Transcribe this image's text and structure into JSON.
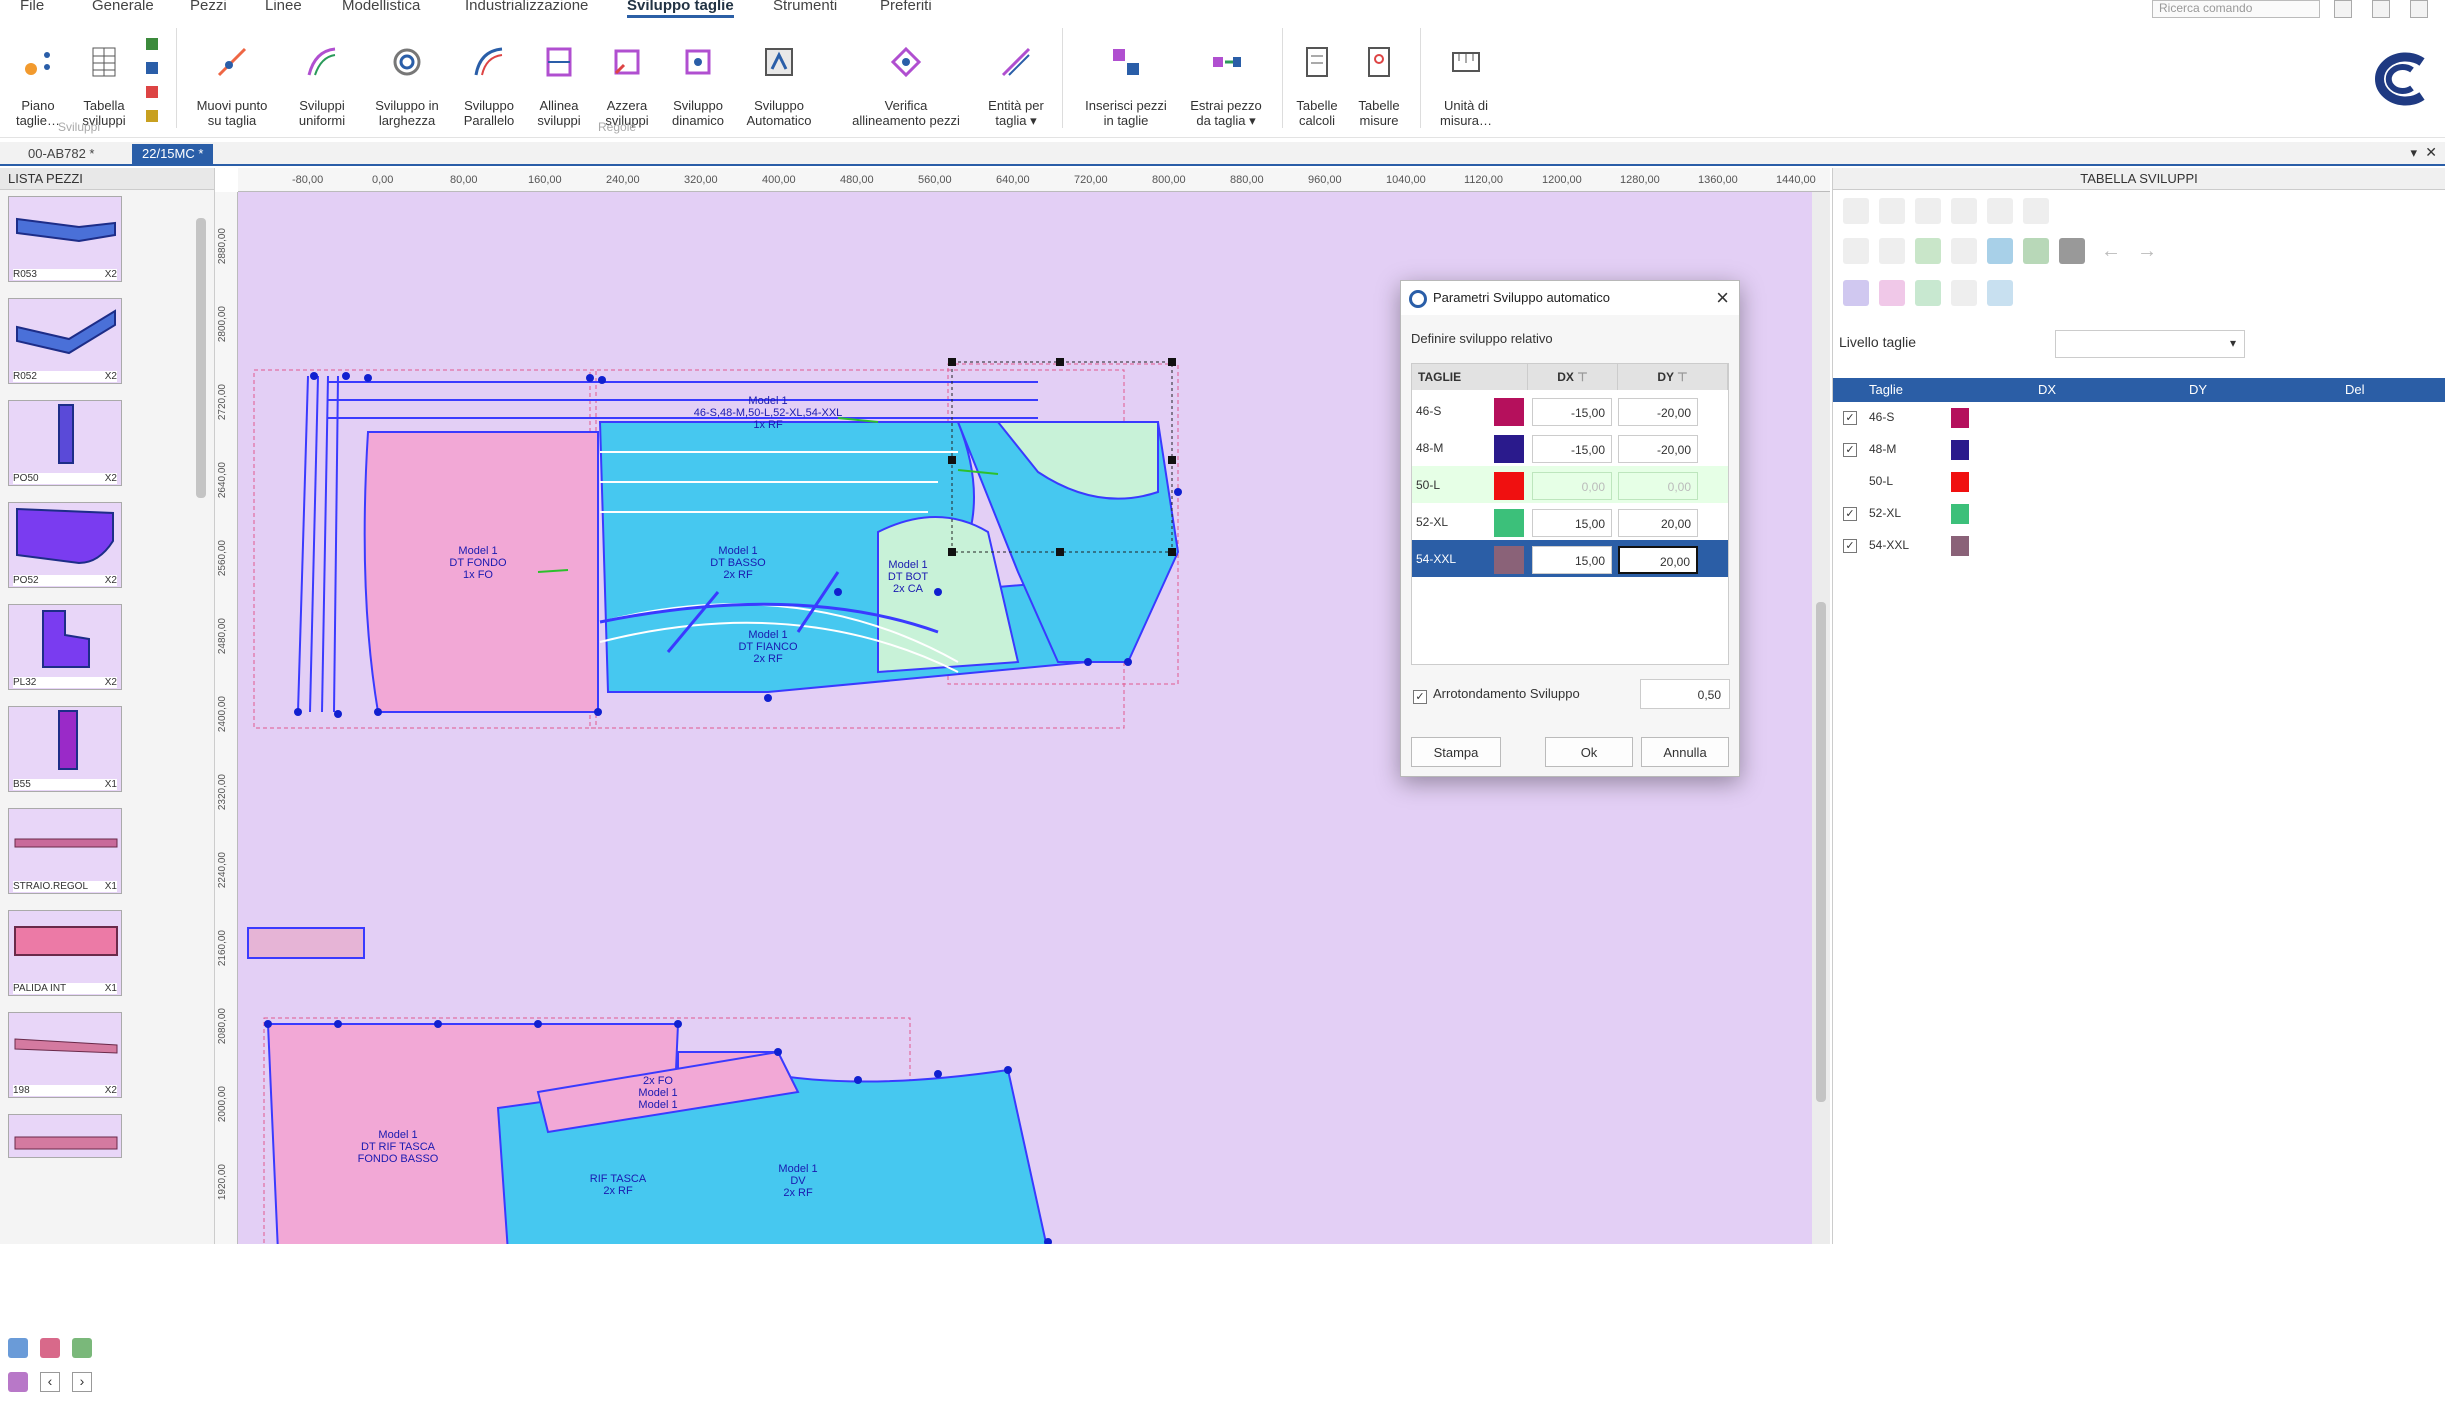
{
  "menu": {
    "items": [
      "File",
      "Generale",
      "Pezzi",
      "Linee",
      "Modellistica",
      "Industrializzazione",
      "Sviluppo taglie",
      "Strumenti",
      "Preferiti"
    ],
    "active": "Sviluppo taglie",
    "search_placeholder": "Ricerca comando"
  },
  "ribbon": {
    "buttons": [
      {
        "label": "Piano\ntaglie…",
        "icon": "size-plan-icon"
      },
      {
        "label": "Tabella\nsviluppi",
        "icon": "table-icon"
      },
      {
        "label": "Muovi punto\nsu taglia",
        "icon": "move-point-icon"
      },
      {
        "label": "Sviluppi\nuniformi",
        "icon": "uniform-grading-icon"
      },
      {
        "label": "Sviluppo in\nlarghezza",
        "icon": "width-grading-icon"
      },
      {
        "label": "Sviluppo\nParallelo",
        "icon": "parallel-grading-icon"
      },
      {
        "label": "Allinea\nsviluppi",
        "icon": "align-grading-icon"
      },
      {
        "label": "Azzera\nsviluppi",
        "icon": "reset-grading-icon"
      },
      {
        "label": "Sviluppo\ndinamico",
        "icon": "dynamic-grading-icon"
      },
      {
        "label": "Sviluppo\nAutomatico",
        "icon": "auto-grading-icon"
      },
      {
        "label": "Verifica\nallineamento pezzi",
        "icon": "verify-alignment-icon"
      },
      {
        "label": "Entità per\ntaglia ▾",
        "icon": "size-entity-icon"
      },
      {
        "label": "Inserisci pezzi\nin taglie",
        "icon": "insert-pieces-icon"
      },
      {
        "label": "Estrai pezzo\nda taglia ▾",
        "icon": "extract-piece-icon"
      },
      {
        "label": "Tabelle\ncalcoli",
        "icon": "calc-table-icon"
      },
      {
        "label": "Tabelle\nmisure",
        "icon": "measure-table-icon"
      },
      {
        "label": "Unità di\nmisura…",
        "icon": "units-icon"
      }
    ],
    "groups": [
      "Sviluppi",
      "Regole"
    ]
  },
  "doc_tabs": [
    "00-AB782 *",
    "22/15MC *"
  ],
  "left_panel": {
    "title": "LISTA PEZZI",
    "pieces": [
      {
        "name": "R053",
        "qty": "X2"
      },
      {
        "name": "R052",
        "qty": "X2"
      },
      {
        "name": "PO50",
        "qty": "X2"
      },
      {
        "name": "PO52",
        "qty": "X2"
      },
      {
        "name": "PL32",
        "qty": "X2"
      },
      {
        "name": "B55",
        "qty": "X1"
      },
      {
        "name": "STRAIO.REGOL",
        "qty": "X1"
      },
      {
        "name": "PALIDA INT",
        "qty": "X1"
      },
      {
        "name": "198",
        "qty": "X2"
      },
      {
        "name": "",
        "qty": ""
      }
    ]
  },
  "ruler": {
    "top": [
      "-80,00",
      "0,00",
      "80,00",
      "160,00",
      "240,00",
      "320,00",
      "400,00",
      "480,00",
      "560,00",
      "640,00",
      "720,00",
      "800,00",
      "880,00",
      "960,00",
      "1040,00",
      "1120,00",
      "1200,00",
      "1280,00",
      "1360,00",
      "1440,00"
    ],
    "left": [
      "2880,00",
      "2800,00",
      "2720,00",
      "2640,00",
      "2560,00",
      "2480,00",
      "2400,00",
      "2320,00",
      "2240,00",
      "2160,00",
      "2080,00",
      "2000,00",
      "1920,00"
    ]
  },
  "canvas_labels": [
    "Model 1",
    "46-S,48-M,50-L,52-XL,54-XXL",
    "1x RF",
    "Model 1",
    "DT FONDO",
    "1x FO",
    "Model 1",
    "DT BASSO",
    "2x RF",
    "Model 1",
    "DT FIANCO",
    "2x RF",
    "Model 1",
    "DT BOT",
    "2x CA",
    "Model 1",
    "DT RIF TASCA",
    "2x FO",
    "Model 1",
    "FONDO BASSO",
    "Model 1",
    "RIF TASCA",
    "2x RF",
    "Model 1",
    "DV",
    "2x RF"
  ],
  "right_panel": {
    "title": "TABELLA SVILUPPI",
    "level_label": "Livello taglie",
    "level_value": "",
    "columns": [
      "Taglie",
      "DX",
      "DY",
      "Del"
    ],
    "rows": [
      {
        "name": "46-S",
        "checked": true,
        "color": "#b5105c"
      },
      {
        "name": "48-M",
        "checked": true,
        "color": "#2a1a8c"
      },
      {
        "name": "50-L",
        "checked": false,
        "color": "#f01010"
      },
      {
        "name": "52-XL",
        "checked": true,
        "color": "#3cc07a"
      },
      {
        "name": "54-XXL",
        "checked": true,
        "color": "#8a6278"
      }
    ]
  },
  "dialog": {
    "title": "Parametri Sviluppo automatico",
    "subtitle": "Definire sviluppo relativo",
    "columns": [
      "TAGLIE",
      "DX",
      "DY"
    ],
    "rows": [
      {
        "name": "46-S",
        "color": "#b5105c",
        "dx": "-15,00",
        "dy": "-20,00",
        "state": "normal"
      },
      {
        "name": "48-M",
        "color": "#2a1a8c",
        "dx": "-15,00",
        "dy": "-20,00",
        "state": "normal"
      },
      {
        "name": "50-L",
        "color": "#f01010",
        "dx": "0,00",
        "dy": "0,00",
        "state": "base"
      },
      {
        "name": "52-XL",
        "color": "#3cc07a",
        "dx": "15,00",
        "dy": "20,00",
        "state": "normal"
      },
      {
        "name": "54-XXL",
        "color": "#8a6278",
        "dx": "15,00",
        "dy": "20,00",
        "state": "selected"
      }
    ],
    "round_label": "Arrotondamento Sviluppo",
    "round_checked": true,
    "round_value": "0,50",
    "buttons": {
      "print": "Stampa",
      "ok": "Ok",
      "cancel": "Annulla"
    }
  },
  "colors": {
    "accent": "#2b5ea6",
    "canvas": "#e3cff5",
    "piece_pink": "#f2a8d6",
    "piece_cyan": "#46c8f0",
    "piece_lightgreen": "#c8f2d8"
  }
}
